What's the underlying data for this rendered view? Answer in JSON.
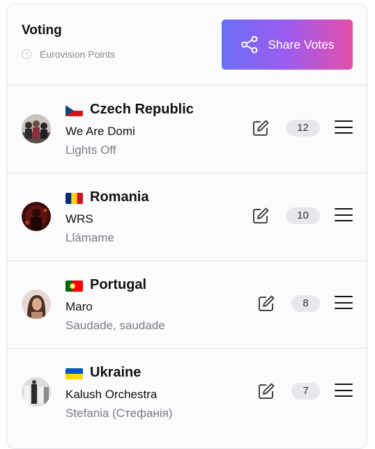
{
  "header": {
    "title": "Voting",
    "subtitle": "Eurovision Points",
    "help_icon": "question-circle-icon",
    "share_label": "Share Votes",
    "share_icon": "share-icon",
    "share_gradient": [
      "#6b6ff4",
      "#9a5cf1",
      "#e44fa8"
    ]
  },
  "entries": [
    {
      "country": "Czech Republic",
      "flag": "flag-cz",
      "artist": "We Are Domi",
      "song": "Lights Off",
      "points": "12"
    },
    {
      "country": "Romania",
      "flag": "flag-ro",
      "artist": "WRS",
      "song": "Llámame",
      "points": "10"
    },
    {
      "country": "Portugal",
      "flag": "flag-pt",
      "artist": "Maro",
      "song": "Saudade, saudade",
      "points": "8"
    },
    {
      "country": "Ukraine",
      "flag": "flag-ua",
      "artist": "Kalush Orchestra",
      "song": "Stefania (Стефанія)",
      "points": "7"
    }
  ],
  "icons": {
    "edit": "edit-icon",
    "drag": "drag-handle-icon"
  }
}
